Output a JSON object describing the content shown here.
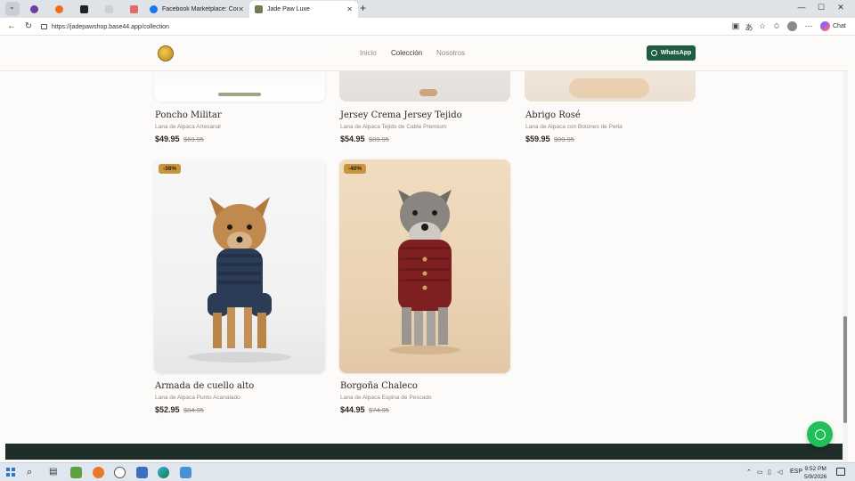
{
  "browser": {
    "tabs": [
      {
        "label": "",
        "color": "#6b3fa0"
      },
      {
        "label": "",
        "color": "#f26b1d"
      },
      {
        "label": "",
        "color": "#222222"
      },
      {
        "label": "",
        "color": "#d9d9d9"
      },
      {
        "label": "",
        "color": "#e26a6a"
      },
      {
        "label": "Facebook Marketplace: Compra y",
        "color": "#1877f2"
      },
      {
        "label": "Jade Paw Luxe",
        "color": "#6f7d4f"
      }
    ],
    "new_tab_glyph": "+",
    "url": "https://jadepawshop.base44.app/collection",
    "chat_label": "Chat",
    "window_controls": [
      "—",
      "☐",
      "✕"
    ]
  },
  "site": {
    "nav": [
      "Inicio",
      "Colección",
      "Nosotros"
    ],
    "whatsapp_label": "WhatsApp"
  },
  "products": [
    {
      "name": "Poncho Militar",
      "subtitle": "Lana de Alpaca Artesanal",
      "price": "$49.95",
      "old_price": "$69.95",
      "badge": ""
    },
    {
      "name": "Jersey Crema Jersey Tejido",
      "subtitle": "Lana de Alpaca Tejido de Cable Premium",
      "price": "$54.95",
      "old_price": "$89.95",
      "badge": ""
    },
    {
      "name": "Abrigo Rosé",
      "subtitle": "Lana de Alpaca con Botones de Perla",
      "price": "$59.95",
      "old_price": "$99.95",
      "badge": ""
    },
    {
      "name": "Armada de cuello alto",
      "subtitle": "Lana de Alpaca Punto Acanalado",
      "price": "$52.95",
      "old_price": "$84.95",
      "badge": "-38%"
    },
    {
      "name": "Borgoña Chaleco",
      "subtitle": "Lana de Alpaca Espina de Pescado",
      "price": "$44.95",
      "old_price": "$74.95",
      "badge": "-40%"
    }
  ],
  "taskbar": {
    "language": "ESP",
    "time": "9:52 PM",
    "date": "5/9/2026"
  }
}
